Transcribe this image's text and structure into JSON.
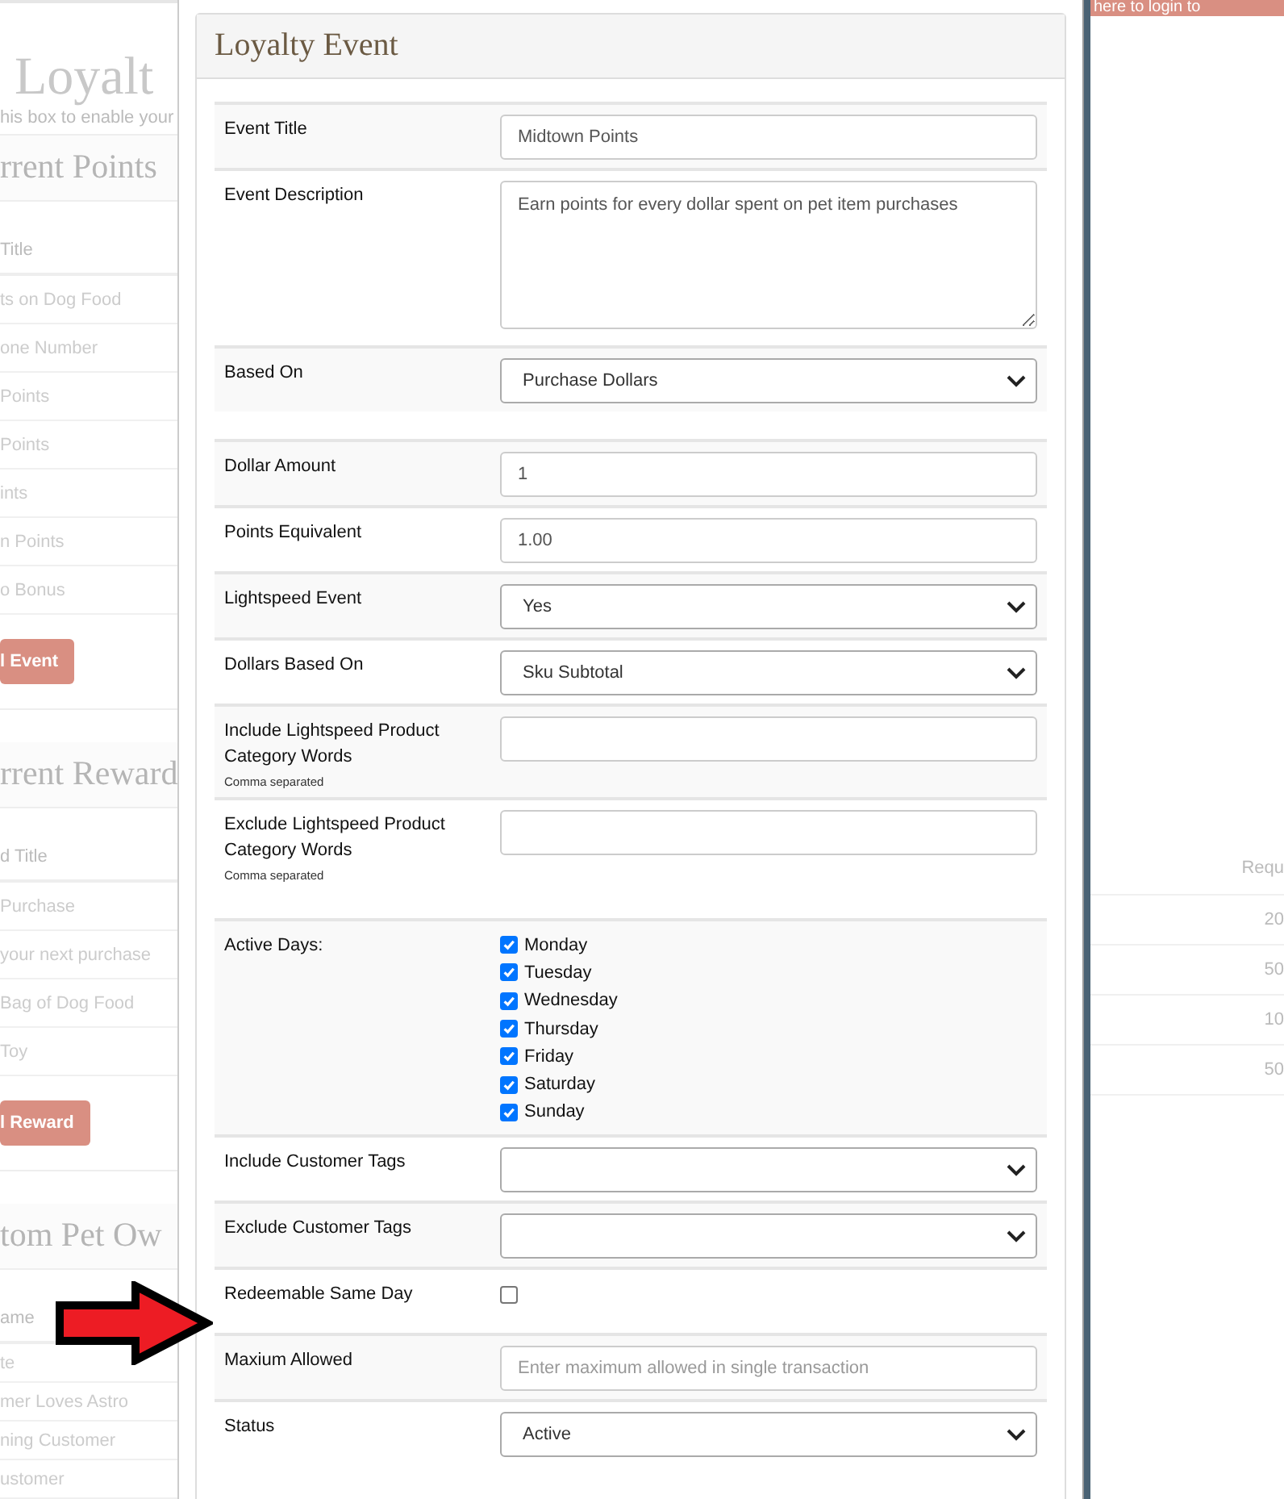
{
  "background": {
    "heading": "Loyalt",
    "note": "his box to enable your",
    "banner": "here to login to",
    "sections": [
      {
        "title": "rrent Points",
        "column": "Title",
        "rows": [
          "ts on Dog Food",
          "one Number",
          "Points",
          "Points",
          "ints",
          "n Points",
          "o Bonus"
        ],
        "button": "l Event"
      },
      {
        "title": "rrent Reward",
        "column": "d Title",
        "rows": [
          "Purchase",
          "your next purchase",
          "Bag of Dog Food",
          "Toy"
        ],
        "button": "l Reward"
      },
      {
        "title": "tom Pet Ow",
        "column": "ame",
        "rows": [
          "te",
          "mer Loves Astro",
          "ning Customer",
          "ustomer"
        ]
      }
    ],
    "right_column": "Requ",
    "right_values": [
      "20",
      "50",
      "10",
      "50"
    ]
  },
  "modal": {
    "title": "Loyalty Event",
    "groups": [
      {
        "rows": [
          {
            "kind": "text",
            "label": "Event Title",
            "value": "Midtown Points"
          },
          {
            "kind": "textarea",
            "label": "Event Description",
            "value": "Earn points for every dollar spent on pet item purchases"
          },
          {
            "kind": "select",
            "label": "Based On",
            "value": "Purchase Dollars"
          }
        ]
      },
      {
        "rows": [
          {
            "kind": "text",
            "label": "Dollar Amount",
            "value": "1"
          },
          {
            "kind": "text",
            "label": "Points Equivalent",
            "value": "1.00"
          },
          {
            "kind": "select",
            "label": "Lightspeed Event",
            "value": "Yes"
          },
          {
            "kind": "select",
            "label": "Dollars Based On",
            "value": "Sku Subtotal"
          },
          {
            "kind": "text",
            "label": "Include Lightspeed Product Category Words",
            "hint": "Comma separated"
          },
          {
            "kind": "text",
            "label": "Exclude Lightspeed Product Category Words",
            "hint": "Comma separated"
          }
        ]
      },
      {
        "rows": [
          {
            "kind": "checkboxes",
            "label": "Active Days:",
            "options": [
              {
                "label": "Monday",
                "checked": true
              },
              {
                "label": "Tuesday",
                "checked": true
              },
              {
                "label": "Wednesday",
                "checked": true
              },
              {
                "label": "Thursday",
                "checked": true
              },
              {
                "label": "Friday",
                "checked": true
              },
              {
                "label": "Saturday",
                "checked": true
              },
              {
                "label": "Sunday",
                "checked": true
              }
            ]
          },
          {
            "kind": "select",
            "label": "Include Customer Tags"
          },
          {
            "kind": "select",
            "label": "Exclude Customer Tags"
          },
          {
            "kind": "checkbox",
            "label": "Redeemable Same Day",
            "checked": false
          },
          {
            "kind": "text",
            "label": "Maxium Allowed",
            "placeholder": "Enter maximum allowed in single transaction"
          },
          {
            "kind": "select",
            "label": "Status",
            "value": "Active"
          }
        ]
      }
    ]
  }
}
